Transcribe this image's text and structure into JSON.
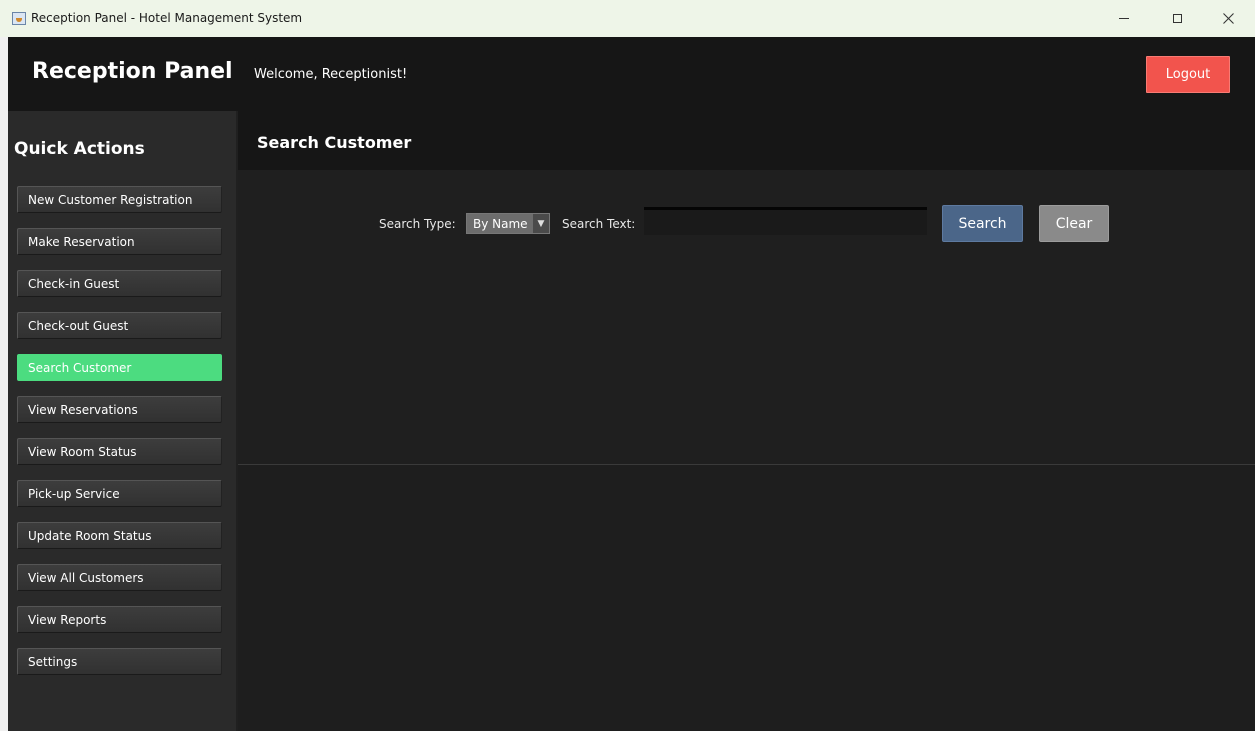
{
  "window": {
    "title": "Reception Panel - Hotel Management System",
    "icon": "java-app-icon"
  },
  "header": {
    "brand": "Reception Panel",
    "welcome": "Welcome, Receptionist!",
    "logout_label": "Logout",
    "logout_color": "#f2544d"
  },
  "sidebar": {
    "title": "Quick Actions",
    "active_color": "#4cdc80",
    "items": [
      {
        "label": "New Customer Registration"
      },
      {
        "label": "Make Reservation"
      },
      {
        "label": "Check-in Guest"
      },
      {
        "label": "Check-out Guest"
      },
      {
        "label": "Search Customer",
        "active": true
      },
      {
        "label": "View Reservations"
      },
      {
        "label": "View Room Status"
      },
      {
        "label": "Pick-up Service"
      },
      {
        "label": "Update Room Status"
      },
      {
        "label": "View All Customers"
      },
      {
        "label": "View Reports"
      },
      {
        "label": "Settings"
      }
    ]
  },
  "content": {
    "title": "Search Customer",
    "search": {
      "type_label": "Search Type:",
      "type_selected": "By Name",
      "text_label": "Search Text:",
      "text_value": "",
      "search_label": "Search",
      "search_color": "#4b6689",
      "clear_label": "Clear"
    }
  }
}
